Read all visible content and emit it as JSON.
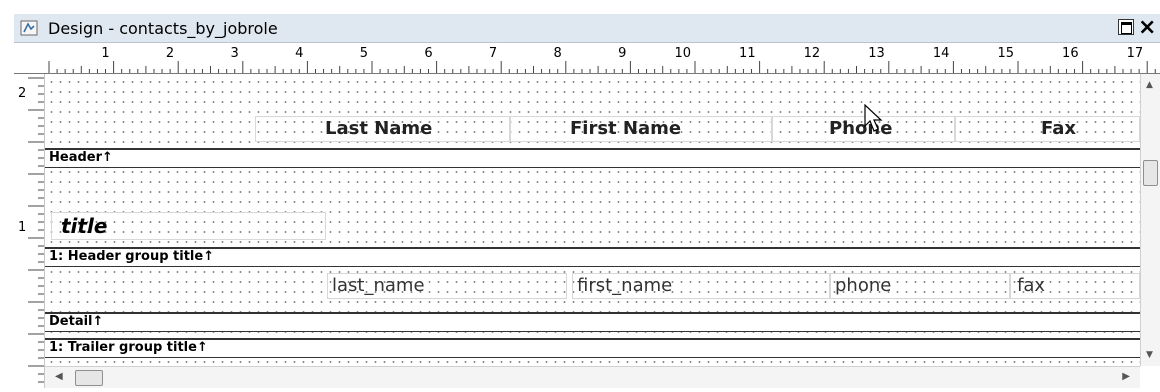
{
  "window": {
    "title": "Design - contacts_by_jobrole",
    "close_glyph": "×",
    "icons": [
      "app-icon",
      "maximize-icon",
      "close-icon"
    ]
  },
  "ruler": {
    "horizontal_labels": [
      "1",
      "2",
      "3",
      "4",
      "5",
      "6",
      "7",
      "8",
      "9",
      "10",
      "11",
      "12",
      "13",
      "14",
      "15",
      "16",
      "17"
    ],
    "vertical_labels": [
      "2",
      "1"
    ]
  },
  "report": {
    "page_header": {
      "columns": [
        "Last Name",
        "First Name",
        "Phone",
        "Fax"
      ]
    },
    "bands": {
      "header": "Header↑",
      "group_header": "1: Header group title↑",
      "detail": "Detail↑",
      "group_trailer": "1: Trailer group title↑"
    },
    "group_field": "title",
    "detail_fields": [
      "last_name",
      "first_name",
      "phone",
      "fax"
    ]
  },
  "scrollbars": {
    "up": "▲",
    "down": "▼",
    "left": "◀",
    "right": "▶"
  }
}
